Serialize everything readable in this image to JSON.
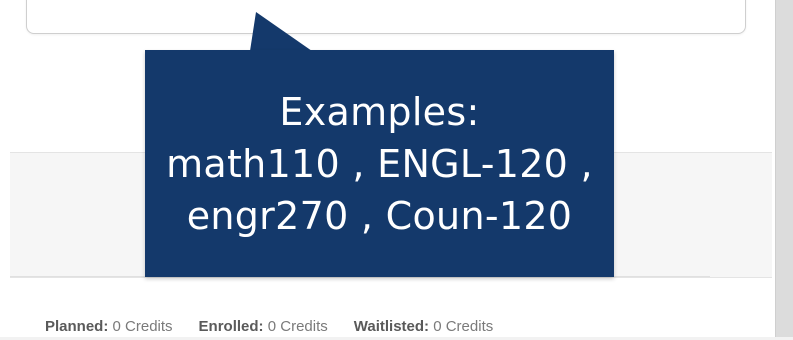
{
  "tooltip": {
    "lines": [
      "Examples:",
      "math110 , ENGL-120 ,",
      "engr270 , Coun-120"
    ]
  },
  "credits": [
    {
      "label": "Planned:",
      "value": "0 Credits"
    },
    {
      "label": "Enrolled:",
      "value": "0 Credits"
    },
    {
      "label": "Waitlisted:",
      "value": "0 Credits"
    }
  ],
  "colors": {
    "tooltip_background": "#14396b",
    "tooltip_text": "#ffffff",
    "page_background": "#ffffff",
    "muted_text": "#7a7a7a"
  }
}
